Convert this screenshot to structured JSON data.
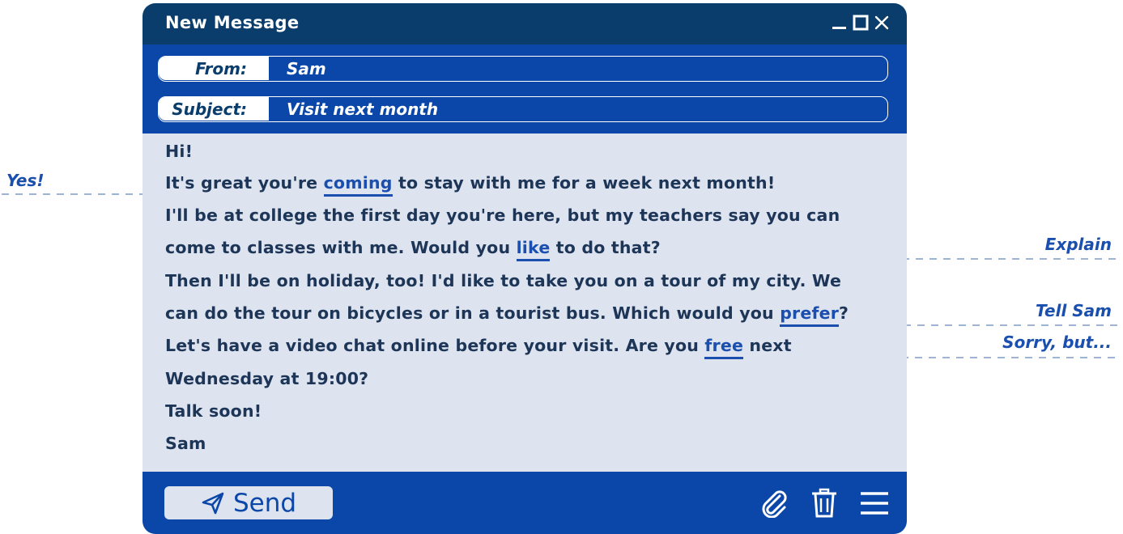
{
  "window": {
    "title": "New Message",
    "controls": [
      "minimize-icon",
      "maximize-icon",
      "close-icon"
    ]
  },
  "header": {
    "from_label": "From:",
    "from_value": "Sam",
    "subject_label": "Subject:",
    "subject_value": "Visit next month"
  },
  "body": {
    "line1": "Hi!",
    "line2_pre": "It's great you're ",
    "line2_hl": "coming",
    "line2_post": " to stay with me for a week next month!",
    "line3": "I'll be at college the first day you're here, but my teachers say you can",
    "line4_pre": "come to classes with me. Would you ",
    "line4_hl": "like",
    "line4_post": " to do that?",
    "line5": "Then I'll be on holiday, too! I'd like to take you on a tour of my city. We",
    "line6_pre": "can do the tour on bicycles or in a tourist bus. Which would you ",
    "line6_hl": "prefer",
    "line6_post": "?",
    "line7_pre": "Let's have a video chat online before your visit. Are you ",
    "line7_hl": "free",
    "line7_post": " next",
    "line8": "Wednesday at 19:00?",
    "line9": "Talk soon!",
    "line10": "Sam"
  },
  "annotations": {
    "yes": "Yes!",
    "explain": "Explain",
    "tell_sam": "Tell Sam",
    "sorry": "Sorry, but..."
  },
  "footer": {
    "send_label": "Send",
    "icons": [
      "paperclip-icon",
      "trash-icon",
      "menu-icon"
    ]
  },
  "colors": {
    "title_bar": "#0a3d6b",
    "header_band": "#0a47a8",
    "body_bg": "#dde3ef",
    "text": "#1d3557",
    "accent": "#1a4fb0"
  }
}
